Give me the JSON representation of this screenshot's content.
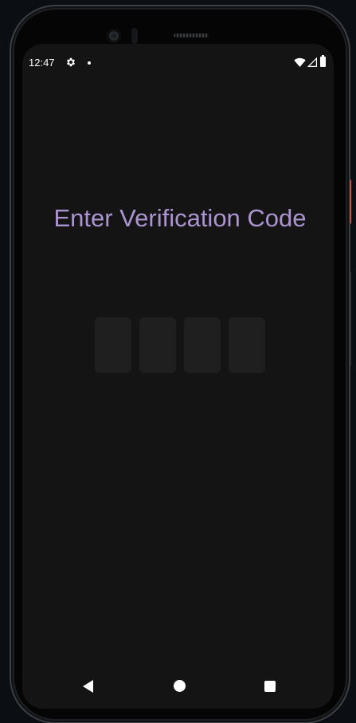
{
  "status_bar": {
    "time": "12:47",
    "icons": [
      "gear-icon",
      "notification-dot-icon",
      "wifi-icon",
      "signal-icon",
      "battery-icon"
    ]
  },
  "screen": {
    "title": "Enter Verification Code",
    "code_inputs": [
      {
        "value": "",
        "placeholder": ""
      },
      {
        "value": "",
        "placeholder": ""
      },
      {
        "value": "",
        "placeholder": ""
      },
      {
        "value": "",
        "placeholder": ""
      }
    ]
  },
  "nav_bar": {
    "icons": [
      "back-icon",
      "home-icon",
      "recents-icon"
    ]
  },
  "colors": {
    "background": "#141414",
    "accent": "#ac94d0",
    "input_background": "#1f1f1f"
  }
}
